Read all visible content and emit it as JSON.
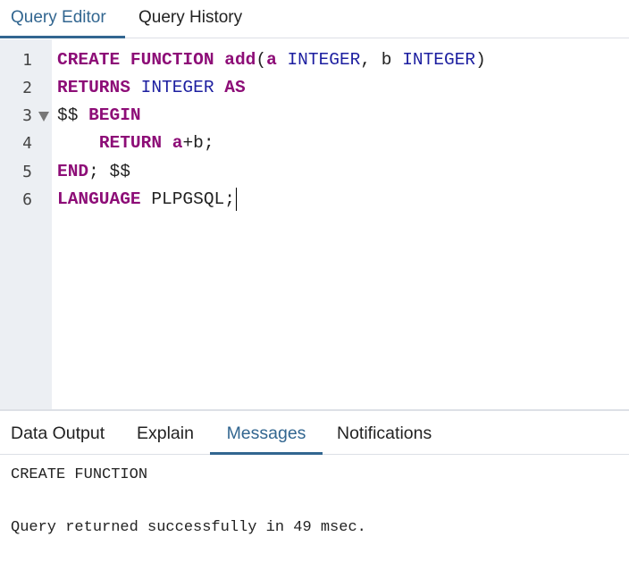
{
  "tabs": {
    "query_editor": "Query Editor",
    "query_history": "Query History",
    "active": "Query Editor"
  },
  "editor": {
    "line_numbers": [
      "1",
      "2",
      "3",
      "4",
      "5",
      "6"
    ],
    "lines": [
      [
        {
          "t": "CREATE",
          "c": "kw"
        },
        {
          "t": " ",
          "c": "id"
        },
        {
          "t": "FUNCTION",
          "c": "kw"
        },
        {
          "t": " ",
          "c": "id"
        },
        {
          "t": "add",
          "c": "kw"
        },
        {
          "t": "(",
          "c": "id"
        },
        {
          "t": "a",
          "c": "kw"
        },
        {
          "t": " ",
          "c": "id"
        },
        {
          "t": "INTEGER",
          "c": "ty"
        },
        {
          "t": ", b ",
          "c": "id"
        },
        {
          "t": "INTEGER",
          "c": "ty"
        },
        {
          "t": ")",
          "c": "id"
        }
      ],
      [
        {
          "t": "RETURNS",
          "c": "kw"
        },
        {
          "t": " ",
          "c": "id"
        },
        {
          "t": "INTEGER",
          "c": "ty"
        },
        {
          "t": " ",
          "c": "id"
        },
        {
          "t": "AS",
          "c": "kw"
        }
      ],
      [
        {
          "t": "$$ ",
          "c": "id"
        },
        {
          "t": "BEGIN",
          "c": "kw"
        }
      ],
      [
        {
          "t": "    ",
          "c": "id"
        },
        {
          "t": "RETURN",
          "c": "kw"
        },
        {
          "t": " ",
          "c": "id"
        },
        {
          "t": "a",
          "c": "kw"
        },
        {
          "t": "+b;",
          "c": "id"
        }
      ],
      [
        {
          "t": "END",
          "c": "kw"
        },
        {
          "t": "; $$",
          "c": "id"
        }
      ],
      [
        {
          "t": "LANGUAGE",
          "c": "kw"
        },
        {
          "t": " PLPGSQL;",
          "c": "id"
        }
      ]
    ],
    "colors": {
      "keyword": "#8d0d77",
      "type": "#1d1fa0",
      "gutter_bg": "#eceff3",
      "accent": "#326690"
    }
  },
  "output_tabs": {
    "data_output": "Data Output",
    "explain": "Explain",
    "messages": "Messages",
    "notifications": "Notifications",
    "active": "Messages"
  },
  "messages": {
    "line1": "CREATE FUNCTION",
    "line2": "Query returned successfully in 49 msec."
  }
}
